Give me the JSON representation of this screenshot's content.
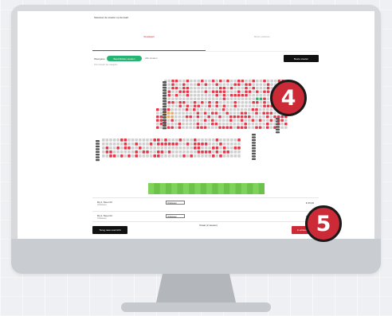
{
  "page": {
    "notice": "Selecteer de stoelen op de kaart",
    "tabs": [
      {
        "label": "Stoelkaart",
        "active": true
      },
      {
        "label": "Beste plaatsen",
        "active": false
      }
    ],
    "view_label": "Weergave",
    "toggle_on": "Beschikbare stoelen",
    "toggle_off": "Alle stoelen",
    "sub_label": "Toon stoelen per categorie",
    "seat_button": "Beste stoelen"
  },
  "selected_seats": [
    {
      "name": "Rij 4, Stoel 23",
      "sub": "Volwassen",
      "ticket_type": "Volwassen",
      "price": "€ 25,00"
    },
    {
      "name": "Rij 4, Stoel 24",
      "sub": "Volwassen",
      "ticket_type": "Volwassen",
      "price": "€ 25,00"
    }
  ],
  "total": {
    "label": "Totaal (2 stoelen)",
    "value": "€ 50,00"
  },
  "buttons": {
    "back": "Terug naar overzicht",
    "cart": "In winkelwagen"
  },
  "steps": {
    "four": "4",
    "five": "5"
  },
  "colors": {
    "available": "#d0d0d0",
    "taken": "#e23a4a",
    "selected": "#27b473",
    "highlight": "#f0a85a",
    "brand": "#cc2a36"
  }
}
